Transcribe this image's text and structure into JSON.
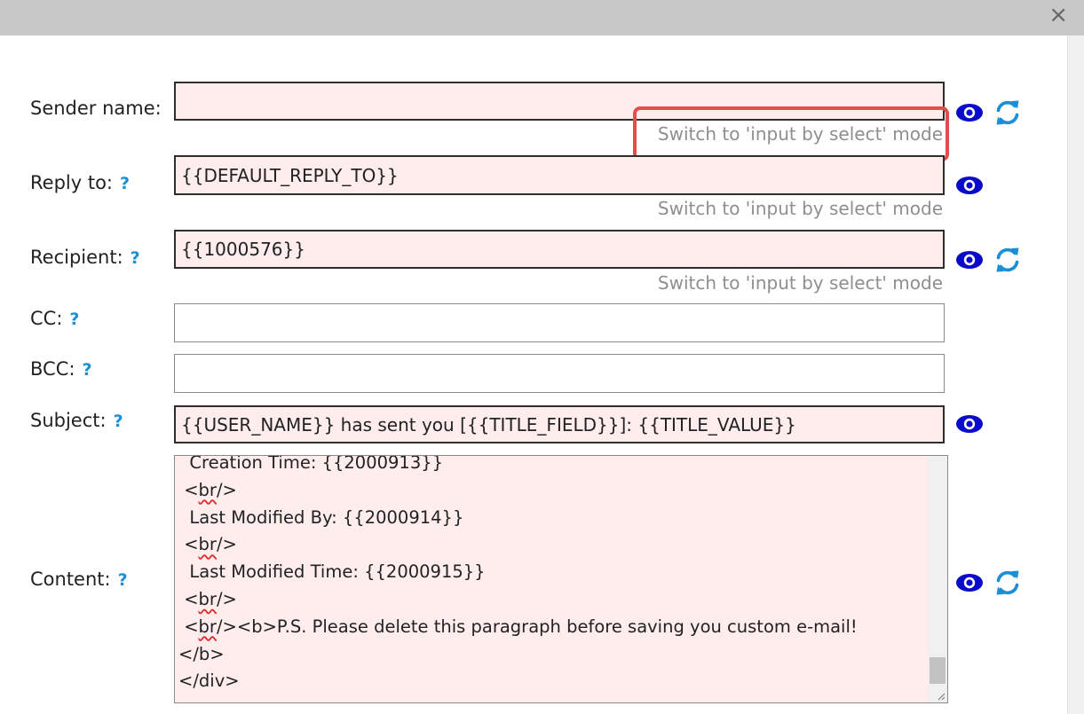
{
  "dialog": {
    "close_glyph": "×"
  },
  "help_glyph": "?",
  "switch_text": "Switch to 'input by select' mode",
  "icons": {
    "eye": "eye-icon",
    "sync": "sync-icon",
    "close": "close-icon"
  },
  "colors": {
    "field_bg": "#ffeded",
    "accent_blue": "#0a0acb",
    "sync_blue": "#1a8fd8",
    "help_blue": "#1a8fd8",
    "highlight_red": "#e84b4b"
  },
  "form": {
    "sender_name": {
      "label": "Sender name:",
      "value": ""
    },
    "reply_to": {
      "label": "Reply to:",
      "value": "{{DEFAULT_REPLY_TO}}"
    },
    "recipient": {
      "label": "Recipient:",
      "value": "{{1000576}}"
    },
    "cc": {
      "label": "CC:",
      "value": ""
    },
    "bcc": {
      "label": "BCC:",
      "value": ""
    },
    "subject": {
      "label": "Subject:",
      "value": "{{USER_NAME}} has sent you [{{TITLE_FIELD}}]: {{TITLE_VALUE}}"
    },
    "content": {
      "label": "Content:",
      "lines": [
        {
          "pre": "  Creation Time: {{2000913}}",
          "sq": "",
          "post": ""
        },
        {
          "pre": " <",
          "sq": "br",
          "post": "/>"
        },
        {
          "pre": "  Last Modified By: {{2000914}}",
          "sq": "",
          "post": ""
        },
        {
          "pre": " <",
          "sq": "br",
          "post": "/>"
        },
        {
          "pre": "  Last Modified Time: {{2000915}}",
          "sq": "",
          "post": ""
        },
        {
          "pre": " <",
          "sq": "br",
          "post": "/>"
        },
        {
          "pre": " <",
          "sq": "br",
          "post": "/><b>P.S. Please delete this paragraph before saving you custom e-mail!"
        },
        {
          "pre": "</b>",
          "sq": "",
          "post": ""
        },
        {
          "pre": "</div>",
          "sq": "",
          "post": ""
        }
      ]
    }
  }
}
